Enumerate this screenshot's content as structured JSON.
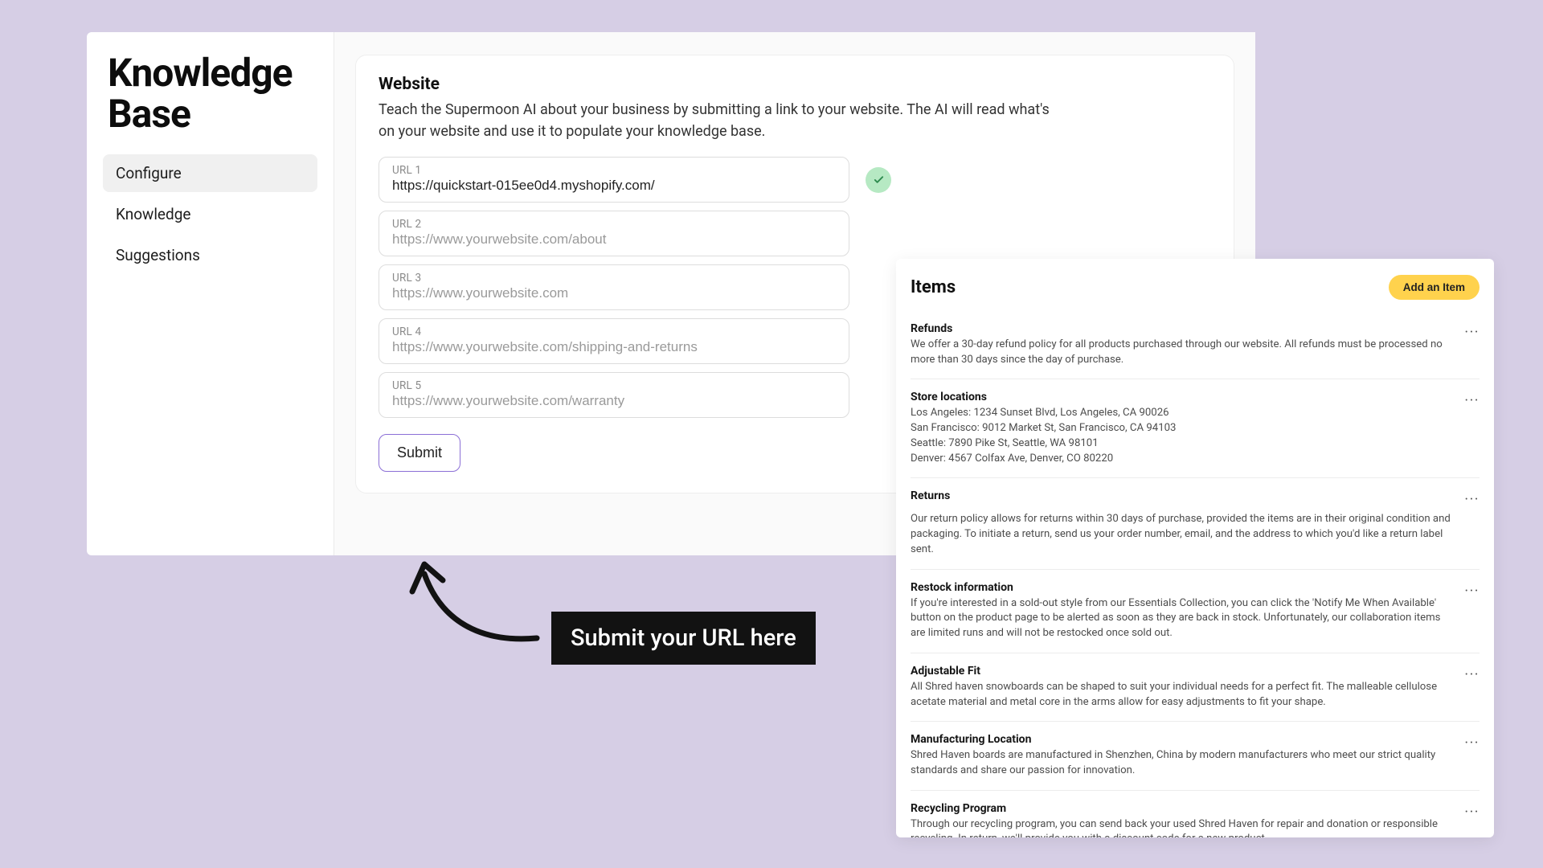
{
  "page": {
    "title": "Knowledge Base"
  },
  "sidebar": {
    "items": [
      {
        "label": "Configure",
        "active": true
      },
      {
        "label": "Knowledge",
        "active": false
      },
      {
        "label": "Suggestions",
        "active": false
      }
    ]
  },
  "website": {
    "title": "Website",
    "description": "Teach the Supermoon AI about your business by submitting a link to your website. The AI will read what's on your website and use it to populate your knowledge base.",
    "fields": [
      {
        "label": "URL 1",
        "value": "https://quickstart-015ee0d4.myshopify.com/",
        "placeholder": "",
        "status": "valid"
      },
      {
        "label": "URL 2",
        "value": "",
        "placeholder": "https://www.yourwebsite.com/about"
      },
      {
        "label": "URL 3",
        "value": "",
        "placeholder": "https://www.yourwebsite.com"
      },
      {
        "label": "URL 4",
        "value": "",
        "placeholder": "https://www.yourwebsite.com/shipping-and-returns"
      },
      {
        "label": "URL 5",
        "value": "",
        "placeholder": "https://www.yourwebsite.com/warranty"
      }
    ],
    "submit_label": "Submit"
  },
  "callout": {
    "text": "Submit your URL here"
  },
  "items_panel": {
    "title": "Items",
    "add_label": "Add an Item",
    "items": [
      {
        "title": "Refunds",
        "body": "We offer a 30-day refund policy for all products purchased through our website. All refunds must be processed no more than 30 days since the day of purchase."
      },
      {
        "title": "Store locations",
        "body": "Los Angeles: 1234 Sunset Blvd, Los Angeles, CA 90026\nSan Francisco: 9012 Market St, San Francisco, CA 94103\nSeattle: 7890 Pike St, Seattle, WA 98101\nDenver: 4567 Colfax Ave, Denver, CO 80220"
      },
      {
        "title": "Returns",
        "body": "Our return policy allows for returns within 30 days of purchase, provided the items are in their original condition and packaging. To initiate a return, send us your order number, email, and the address to which you'd like a return label sent.",
        "gap": true
      },
      {
        "title": "Restock information",
        "body": "If you're interested in a sold-out style from our Essentials Collection, you can click the 'Notify Me When Available' button on the product page to be alerted as soon as they are back in stock. Unfortunately, our collaboration items are limited runs and will not be restocked once sold out."
      },
      {
        "title": "Adjustable Fit",
        "body": "All Shred haven snowboards can be shaped to suit your individual needs for a perfect fit. The malleable cellulose acetate material and metal core in the arms allow for easy adjustments to fit your shape."
      },
      {
        "title": "Manufacturing Location",
        "body": "Shred Haven boards are manufactured in Shenzhen, China by modern manufacturers who meet our strict quality standards and share our passion for innovation."
      },
      {
        "title": "Recycling Program",
        "body": "Through our recycling program, you can send back your used Shred Haven for repair and donation or responsible recycling. In return, we'll provide you with a discount code for a new product."
      }
    ]
  }
}
